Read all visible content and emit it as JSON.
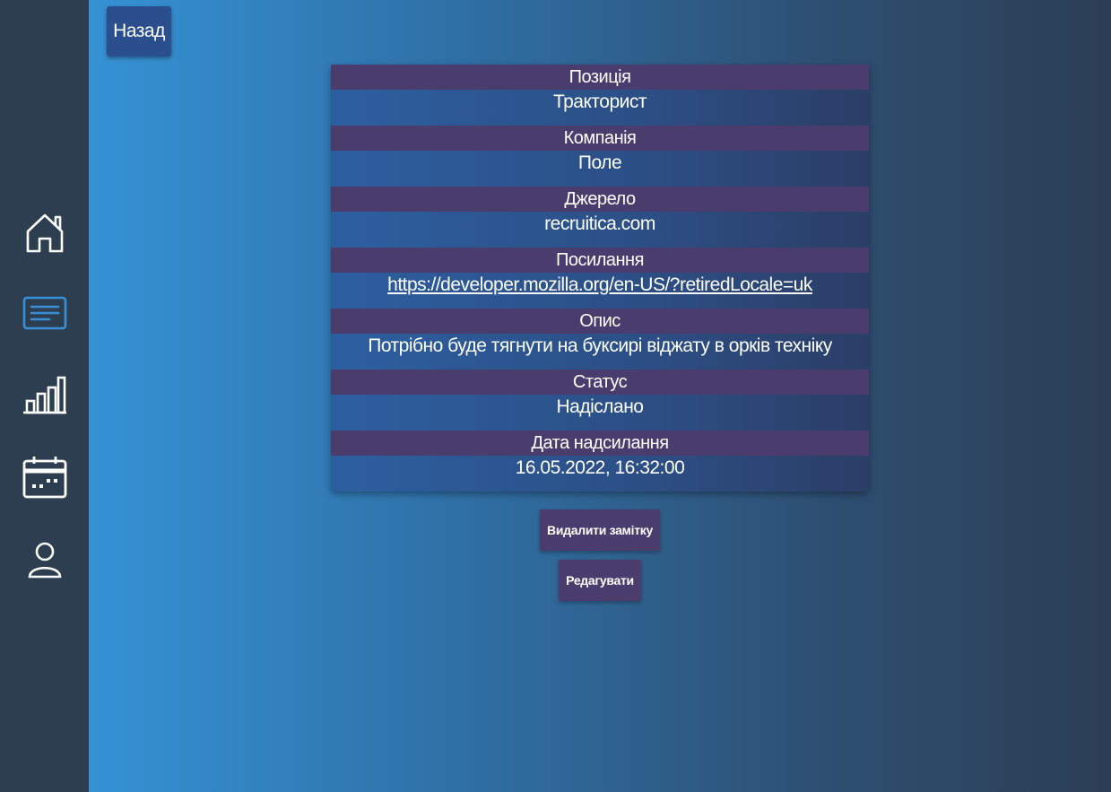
{
  "sidebar": {
    "items": [
      {
        "icon": "home-icon",
        "active": false
      },
      {
        "icon": "notes-icon",
        "active": true
      },
      {
        "icon": "stats-icon",
        "active": false
      },
      {
        "icon": "calendar-icon",
        "active": false
      },
      {
        "icon": "user-icon",
        "active": false
      }
    ],
    "colors": {
      "active": "#3a8fd6",
      "inactive": "#ffffff"
    }
  },
  "header": {
    "back_label": "Назад"
  },
  "details": {
    "position_label": "Позиція",
    "position_value": "Тракторист",
    "company_label": "Компанія",
    "company_value": "Поле",
    "source_label": "Джерело",
    "source_value": "recruitica.com",
    "link_label": "Посилання",
    "link_value": "https://developer.mozilla.org/en-US/?retiredLocale=uk",
    "description_label": "Опис",
    "description_value": "Потрібно буде тягнути на буксирі віджату в орків техніку",
    "status_label": "Статус",
    "status_value": "Надіслано",
    "date_label": "Дата надсилання",
    "date_value": "16.05.2022, 16:32:00"
  },
  "actions": {
    "delete_label": "Видалити замітку",
    "edit_label": "Редагувати"
  }
}
